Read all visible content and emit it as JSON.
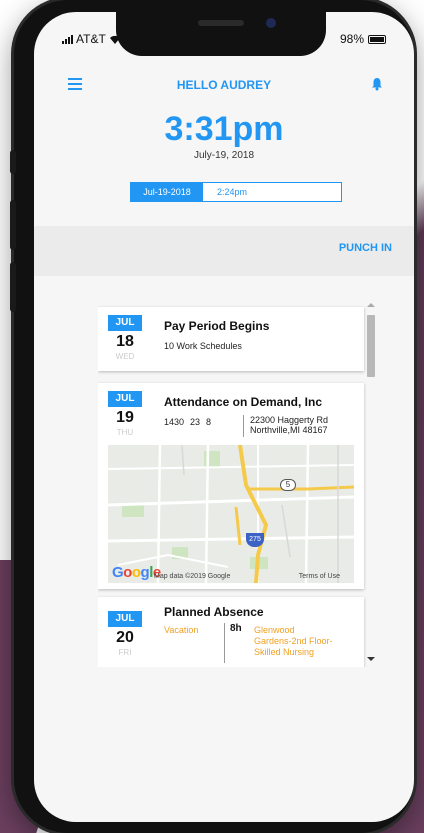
{
  "status": {
    "carrier": "AT&T",
    "battery": "98%",
    "battery_level": 0.98
  },
  "header": {
    "title": "HELLO AUDREY",
    "menu_icon": "hamburger-menu-icon",
    "bell_icon": "bell-icon"
  },
  "clock": {
    "time": "3:31pm",
    "date": "July-19, 2018"
  },
  "punch": {
    "date": "Jul-19-2018",
    "time": "2:24pm",
    "action_label": "PUNCH IN"
  },
  "colors": {
    "accent": "#2196f3",
    "orange": "#f0a020"
  },
  "events": [
    {
      "month": "JUL",
      "day": "18",
      "weekday": "WED",
      "title": "Pay Period Begins",
      "subtitle": "10 Work Schedules"
    },
    {
      "month": "JUL",
      "day": "19",
      "weekday": "THU",
      "title": "Attendance on Demand, Inc",
      "time_start": "1430",
      "time_end": "23",
      "hours": "8",
      "address_line1": "22300 Haggerty Rd",
      "address_line2": "Northville,MI 48167",
      "map": {
        "google_label": "Google",
        "data_text": "Map data ©2019 Google",
        "terms_text": "Terms of Use",
        "shield_5": "5",
        "shield_275": "275"
      }
    },
    {
      "month": "JUL",
      "day": "20",
      "weekday": "FRI",
      "title": "Planned Absence",
      "type": "Vacation",
      "hours": "8h",
      "location": "Glenwood Gardens-2nd Floor-Skilled Nursing"
    }
  ]
}
